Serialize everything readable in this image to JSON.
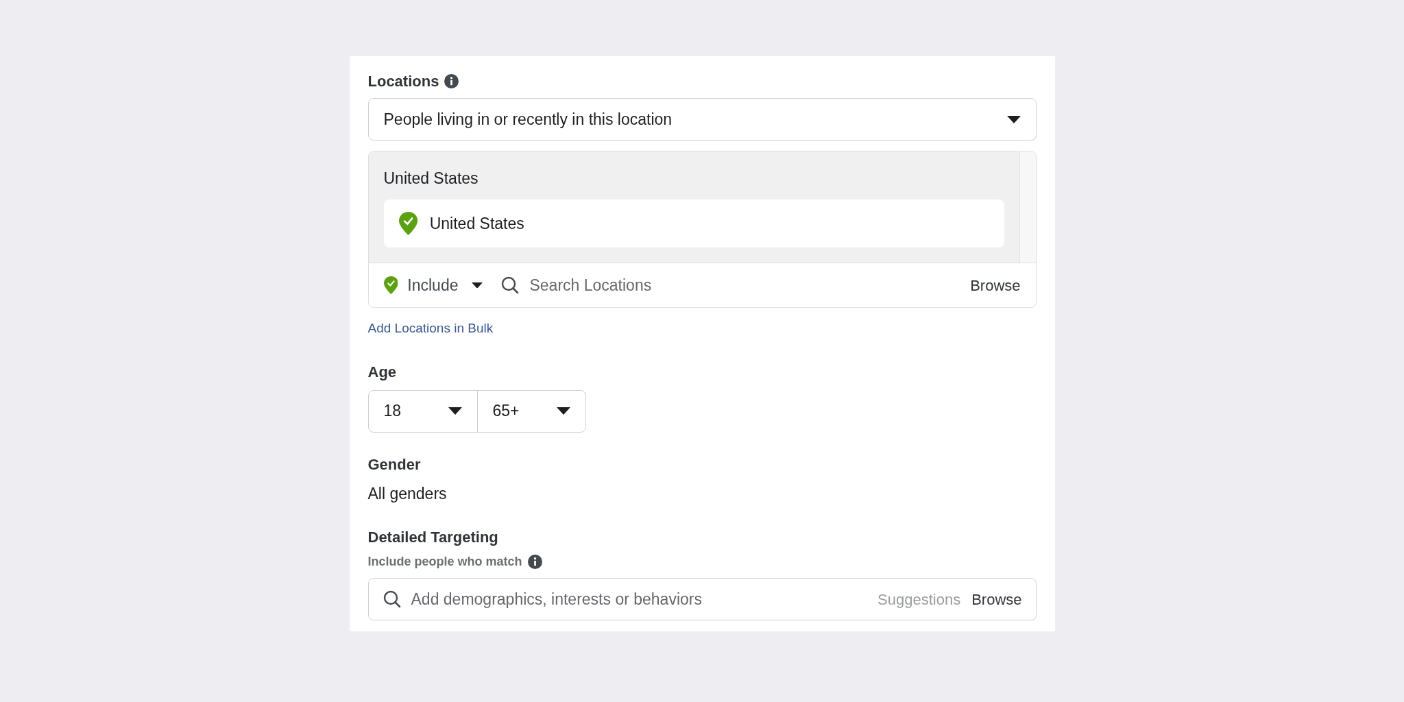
{
  "locations": {
    "label": "Locations",
    "audience_type": "People living in or recently in this location",
    "groups": [
      {
        "heading": "United States",
        "items": [
          {
            "name": "United States",
            "kind": "included"
          }
        ]
      }
    ],
    "mode": {
      "label": "Include",
      "kind": "included"
    },
    "search_placeholder": "Search Locations",
    "browse": "Browse",
    "bulk_link": "Add Locations in Bulk"
  },
  "age": {
    "label": "Age",
    "min": "18",
    "max": "65+"
  },
  "gender": {
    "label": "Gender",
    "value": "All genders"
  },
  "detailed_targeting": {
    "label": "Detailed Targeting",
    "hint": "Include people who match",
    "placeholder": "Add demographics, interests or behaviors",
    "suggestions": "Suggestions",
    "browse": "Browse"
  }
}
